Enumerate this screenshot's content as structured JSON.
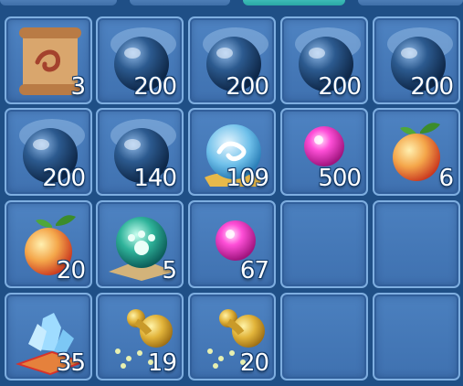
{
  "inventory": {
    "tabs": [
      {
        "label": "",
        "active": false
      },
      {
        "label": "",
        "active": false
      },
      {
        "label": "",
        "active": true
      },
      {
        "label": "",
        "active": false
      }
    ],
    "slots": [
      {
        "item": "scroll-icon",
        "count": "3"
      },
      {
        "item": "dark-orb-icon",
        "count": "200"
      },
      {
        "item": "dark-orb-icon",
        "count": "200"
      },
      {
        "item": "dark-orb-icon",
        "count": "200"
      },
      {
        "item": "dark-orb-icon",
        "count": "200"
      },
      {
        "item": "dark-orb-icon",
        "count": "200"
      },
      {
        "item": "dark-orb-icon",
        "count": "140"
      },
      {
        "item": "cloud-orb-icon",
        "count": "109"
      },
      {
        "item": "pink-pearl-icon",
        "count": "500"
      },
      {
        "item": "peach-icon",
        "count": "6"
      },
      {
        "item": "peach-icon",
        "count": "20"
      },
      {
        "item": "paw-orb-icon",
        "count": "5"
      },
      {
        "item": "pink-pearl-icon",
        "count": "67"
      },
      {
        "item": "",
        "count": ""
      },
      {
        "item": "",
        "count": ""
      },
      {
        "item": "crystal-cushion-icon",
        "count": "35"
      },
      {
        "item": "golden-gourd-icon",
        "count": "19"
      },
      {
        "item": "golden-gourd-icon",
        "count": "20"
      },
      {
        "item": "",
        "count": ""
      },
      {
        "item": "",
        "count": ""
      }
    ]
  },
  "colors": {
    "background": "#1f4f86",
    "slot_fill": "#4a7fbf",
    "slot_border": "#7eaee0",
    "tab_active": "#3cc0b8"
  }
}
